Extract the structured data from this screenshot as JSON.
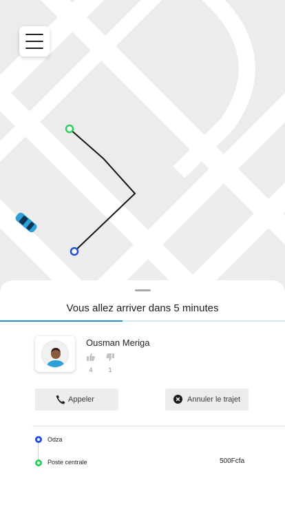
{
  "app": {
    "eta_text": "Vous allez arriver dans 5 minutes",
    "eta_progress": 0.43
  },
  "map": {
    "pickup_color": "#2ad05a",
    "dropoff_color": "#1d4fd8",
    "vehicle_color": "#2a9fd8",
    "menu_icon": "hamburger-menu-icon"
  },
  "driver": {
    "name": "Ousman Meriga",
    "likes": "4",
    "dislikes": "1"
  },
  "actions": {
    "call_label": "Appeler",
    "cancel_label": "Annuler le trajet"
  },
  "trip": {
    "origin": "Odza",
    "destination": "Poste centrale",
    "price": "500Fcfa"
  }
}
